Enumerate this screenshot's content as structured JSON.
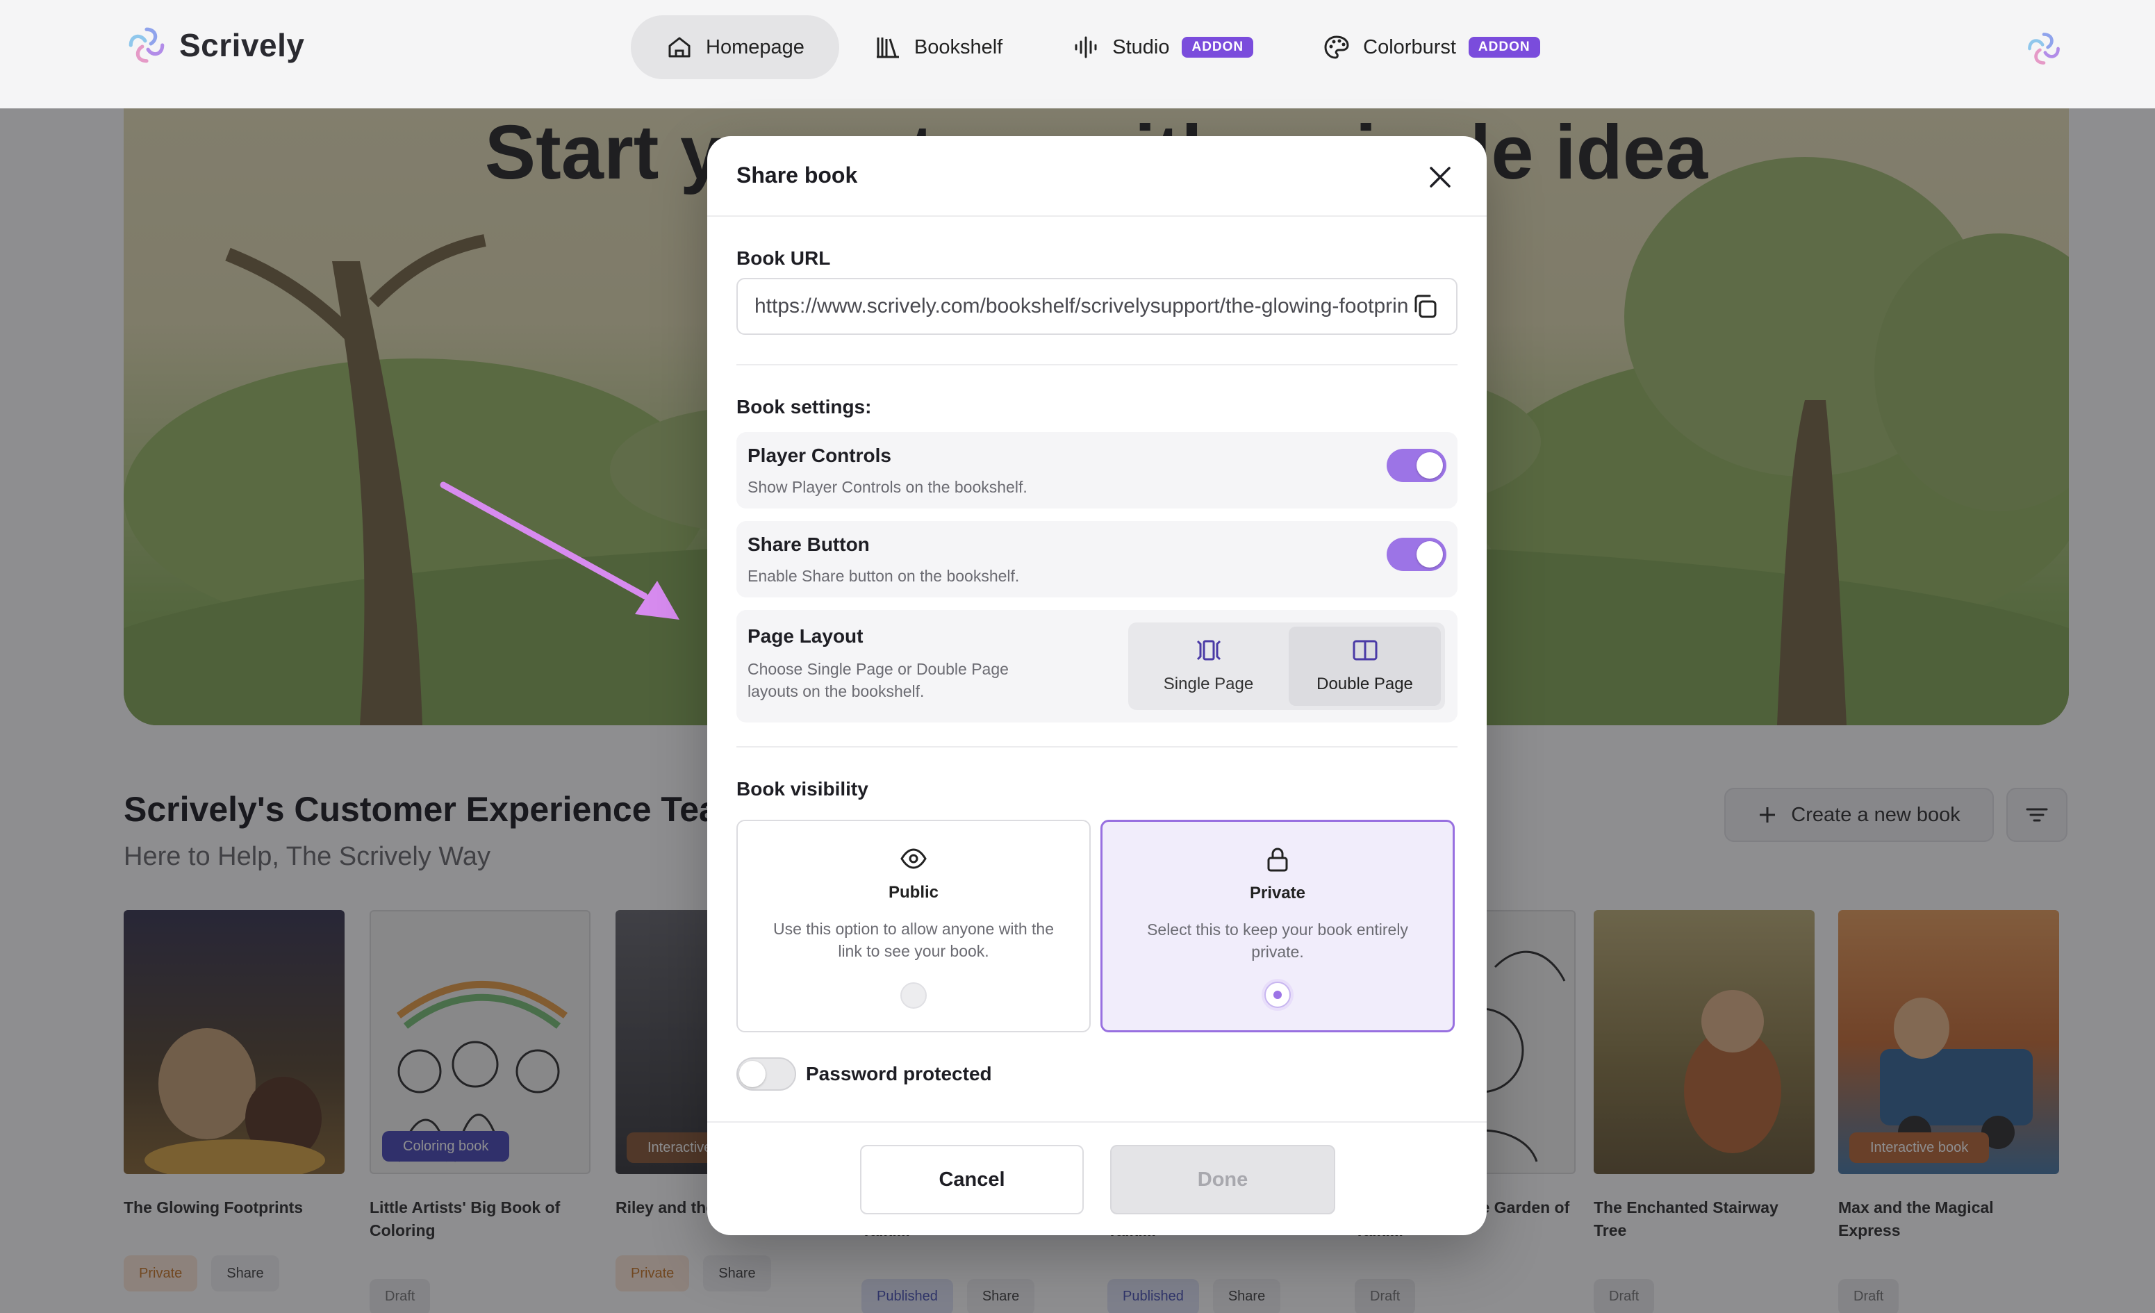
{
  "app": {
    "name": "Scrively"
  },
  "nav": {
    "items": [
      {
        "label": "Homepage",
        "icon": "home-icon",
        "active": true
      },
      {
        "label": "Bookshelf",
        "icon": "bookshelf-icon"
      },
      {
        "label": "Studio",
        "icon": "audio-wave-icon",
        "badge": "ADDON"
      },
      {
        "label": "Colorburst",
        "icon": "palette-icon",
        "badge": "ADDON"
      }
    ]
  },
  "hero": {
    "title": "Start your story with a single idea"
  },
  "section": {
    "title": "Scrively's Customer Experience Team",
    "subtitle": "Here to Help, The Scrively Way",
    "create_label": "Create a new book"
  },
  "books": [
    {
      "title": "The Glowing Footprints",
      "tags": [
        "Private",
        "Share"
      ]
    },
    {
      "title": "Little Artists' Big Book of Coloring",
      "badge": "Coloring book",
      "tags": [
        "Draft"
      ]
    },
    {
      "title": "Riley and the Missing Color",
      "badge": "Interactive book",
      "tags": [
        "Private",
        "Share"
      ]
    },
    {
      "title": "Adventures in the Garden of Talki...",
      "tags": [
        "Published",
        "Share"
      ]
    },
    {
      "title": "Adventures in the Garden of Talki...",
      "tags": [
        "Published",
        "Share"
      ]
    },
    {
      "title": "Adventures in the Garden of Talki...",
      "tags": [
        "Draft"
      ]
    },
    {
      "title": "The Enchanted Stairway Tree",
      "tags": [
        "Draft"
      ]
    },
    {
      "title": "Max and the Magical Express",
      "badge": "Interactive book",
      "tags": [
        "Draft"
      ]
    }
  ],
  "modal": {
    "title": "Share book",
    "url_label": "Book URL",
    "url_value": "https://www.scrively.com/bookshelf/scrivelysupport/the-glowing-footprints",
    "settings_label": "Book settings:",
    "player_controls": {
      "name": "Player Controls",
      "desc": "Show Player Controls on the bookshelf.",
      "enabled": true
    },
    "share_button": {
      "name": "Share Button",
      "desc": "Enable Share button on the bookshelf.",
      "enabled": true
    },
    "page_layout": {
      "name": "Page Layout",
      "desc": "Choose Single Page or Double Page layouts on the bookshelf.",
      "options": [
        "Single Page",
        "Double Page"
      ],
      "selected": "Double Page"
    },
    "visibility_label": "Book visibility",
    "visibility": {
      "public": {
        "title": "Public",
        "desc": "Use this option to allow anyone with the link to see your book."
      },
      "private": {
        "title": "Private",
        "desc": "Select this to keep your book entirely private."
      },
      "selected": "Private"
    },
    "password_label": "Password protected",
    "password_enabled": false,
    "cancel_label": "Cancel",
    "done_label": "Done"
  },
  "colors": {
    "accent": "#9c74e6",
    "addon_badge": "#7a4cdc"
  }
}
